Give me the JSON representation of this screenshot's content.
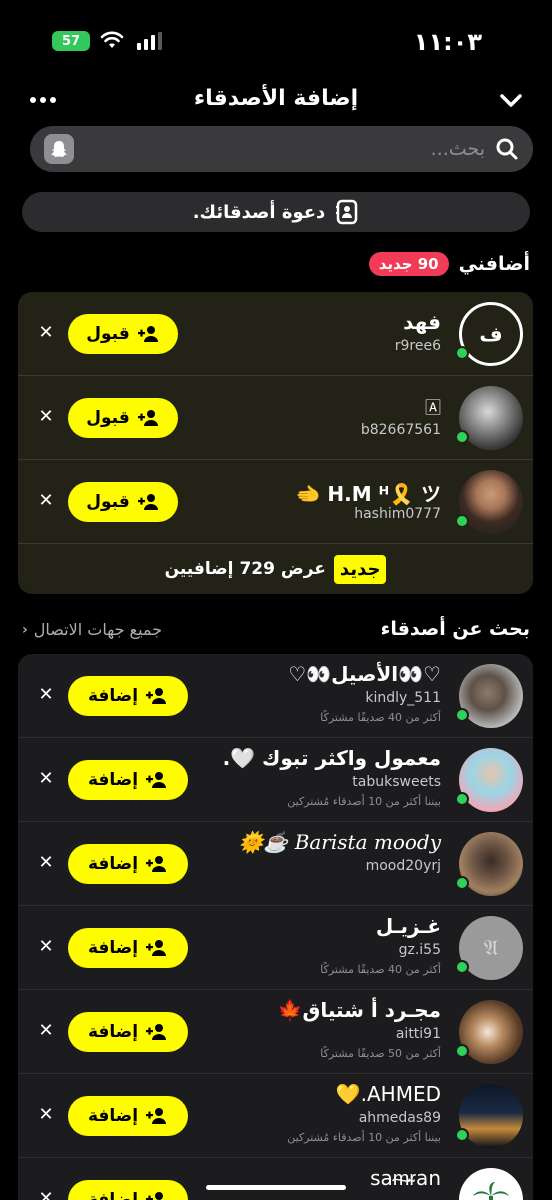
{
  "status_bar": {
    "time": "١١:٠٣",
    "battery": "57"
  },
  "header": {
    "title": "إضافة الأصدقاء"
  },
  "search": {
    "placeholder": "بحث..."
  },
  "invite": {
    "label": "دعوة أصدقائك."
  },
  "added_me": {
    "title": "أضافني",
    "badge": "90 جديد",
    "rows": [
      {
        "name": "فهد",
        "username": "r9ree6",
        "avatar_letter": "ف",
        "action": "قبول"
      },
      {
        "name": "🄰",
        "username": "b82667561",
        "action": "قبول"
      },
      {
        "name": "H.M ᴴ🎗️ ツ 🫲",
        "username": "hashim0777",
        "action": "قبول"
      }
    ],
    "new_pill": "جديد",
    "view_more": "عرض 729 إضافيين"
  },
  "find_friends": {
    "title": "بحث عن أصدقاء",
    "all_contacts": "جميع جهات الاتصال",
    "rows": [
      {
        "name": "♡👀الأصيل👀♡",
        "username": "kindly_511",
        "mutual": "أكثر من 40 صديقًا مشتركًا",
        "action": "إضافة"
      },
      {
        "name": "معمول واكثر تبوك 🤍.",
        "username": "tabuksweets",
        "mutual": "بيننا أكثر من 10 أصدقاء مُشتركين",
        "action": "إضافة"
      },
      {
        "name": "Barista moody ☕🌞",
        "username": "mood20yrj",
        "mutual": "",
        "action": "إضافة"
      },
      {
        "name": "غـزيـل",
        "username": "gz.i55",
        "mutual": "أكثر من 40 صديقًا مشتركًا",
        "action": "إضافة"
      },
      {
        "name": "مجـرد أ شتياق🍁",
        "username": "aitti91",
        "mutual": "أكثر من 50 صديقًا مشتركًا",
        "action": "إضافة"
      },
      {
        "name": "AHMED.💛",
        "username": "ahmedas89",
        "mutual": "بيننا أكثر من 10 أصدقاء مُشتركين",
        "action": "إضافة"
      },
      {
        "name": "saᵯᵲan",
        "username": "",
        "mutual": "",
        "action": "إضافة"
      }
    ]
  },
  "colors": {
    "accent": "#fffc00",
    "online": "#2fd158",
    "badge": "#f23c57"
  }
}
